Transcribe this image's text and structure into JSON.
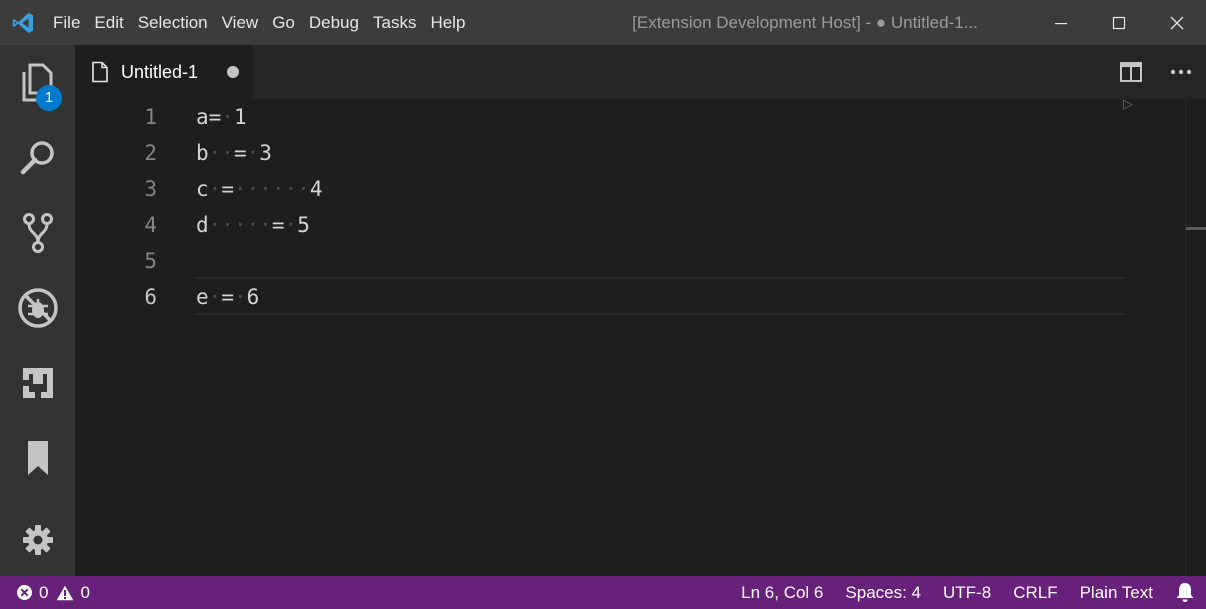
{
  "app": {
    "window_title": "[Extension Development Host] - ● Untitled-1..."
  },
  "menu": [
    "File",
    "Edit",
    "Selection",
    "View",
    "Go",
    "Debug",
    "Tasks",
    "Help"
  ],
  "activity": {
    "explorer_badge": "1"
  },
  "tab": {
    "label": "Untitled-1"
  },
  "editor": {
    "lines": [
      {
        "num": "1",
        "segments": [
          {
            "t": "a=",
            "ws": false
          },
          {
            "t": "·",
            "ws": true
          },
          {
            "t": "1",
            "ws": false
          }
        ]
      },
      {
        "num": "2",
        "segments": [
          {
            "t": "b",
            "ws": false
          },
          {
            "t": "··",
            "ws": true
          },
          {
            "t": "=",
            "ws": false
          },
          {
            "t": "·",
            "ws": true
          },
          {
            "t": "3",
            "ws": false
          }
        ]
      },
      {
        "num": "3",
        "segments": [
          {
            "t": "c",
            "ws": false
          },
          {
            "t": "·",
            "ws": true
          },
          {
            "t": "=",
            "ws": false
          },
          {
            "t": "······",
            "ws": true
          },
          {
            "t": "4",
            "ws": false
          }
        ]
      },
      {
        "num": "4",
        "segments": [
          {
            "t": "d",
            "ws": false
          },
          {
            "t": "·····",
            "ws": true
          },
          {
            "t": "=",
            "ws": false
          },
          {
            "t": "·",
            "ws": true
          },
          {
            "t": "5",
            "ws": false
          }
        ]
      },
      {
        "num": "5",
        "segments": []
      },
      {
        "num": "6",
        "segments": [
          {
            "t": "e",
            "ws": false
          },
          {
            "t": "·",
            "ws": true
          },
          {
            "t": "=",
            "ws": false
          },
          {
            "t": "·",
            "ws": true
          },
          {
            "t": "6",
            "ws": false
          }
        ]
      }
    ],
    "active_line": "6"
  },
  "status": {
    "errors": "0",
    "warnings": "0",
    "position": "Ln 6, Col 6",
    "indentation": "Spaces: 4",
    "encoding": "UTF-8",
    "eol": "CRLF",
    "language": "Plain Text"
  },
  "colors": {
    "statusbar": "#68217a",
    "badge": "#007acc",
    "activitybar": "#333333",
    "titlebar": "#3c3c3c",
    "editor_bg": "#1e1e1e"
  },
  "icons": {
    "activity": [
      "files-icon",
      "search-icon",
      "source-control-icon",
      "debug-icon",
      "extensions-icon",
      "bookmark-icon",
      "gear-icon"
    ],
    "tab": [
      "file-icon",
      "split-editor-icon",
      "more-actions-icon"
    ],
    "status": [
      "error-icon",
      "warning-icon",
      "bell-icon"
    ]
  }
}
